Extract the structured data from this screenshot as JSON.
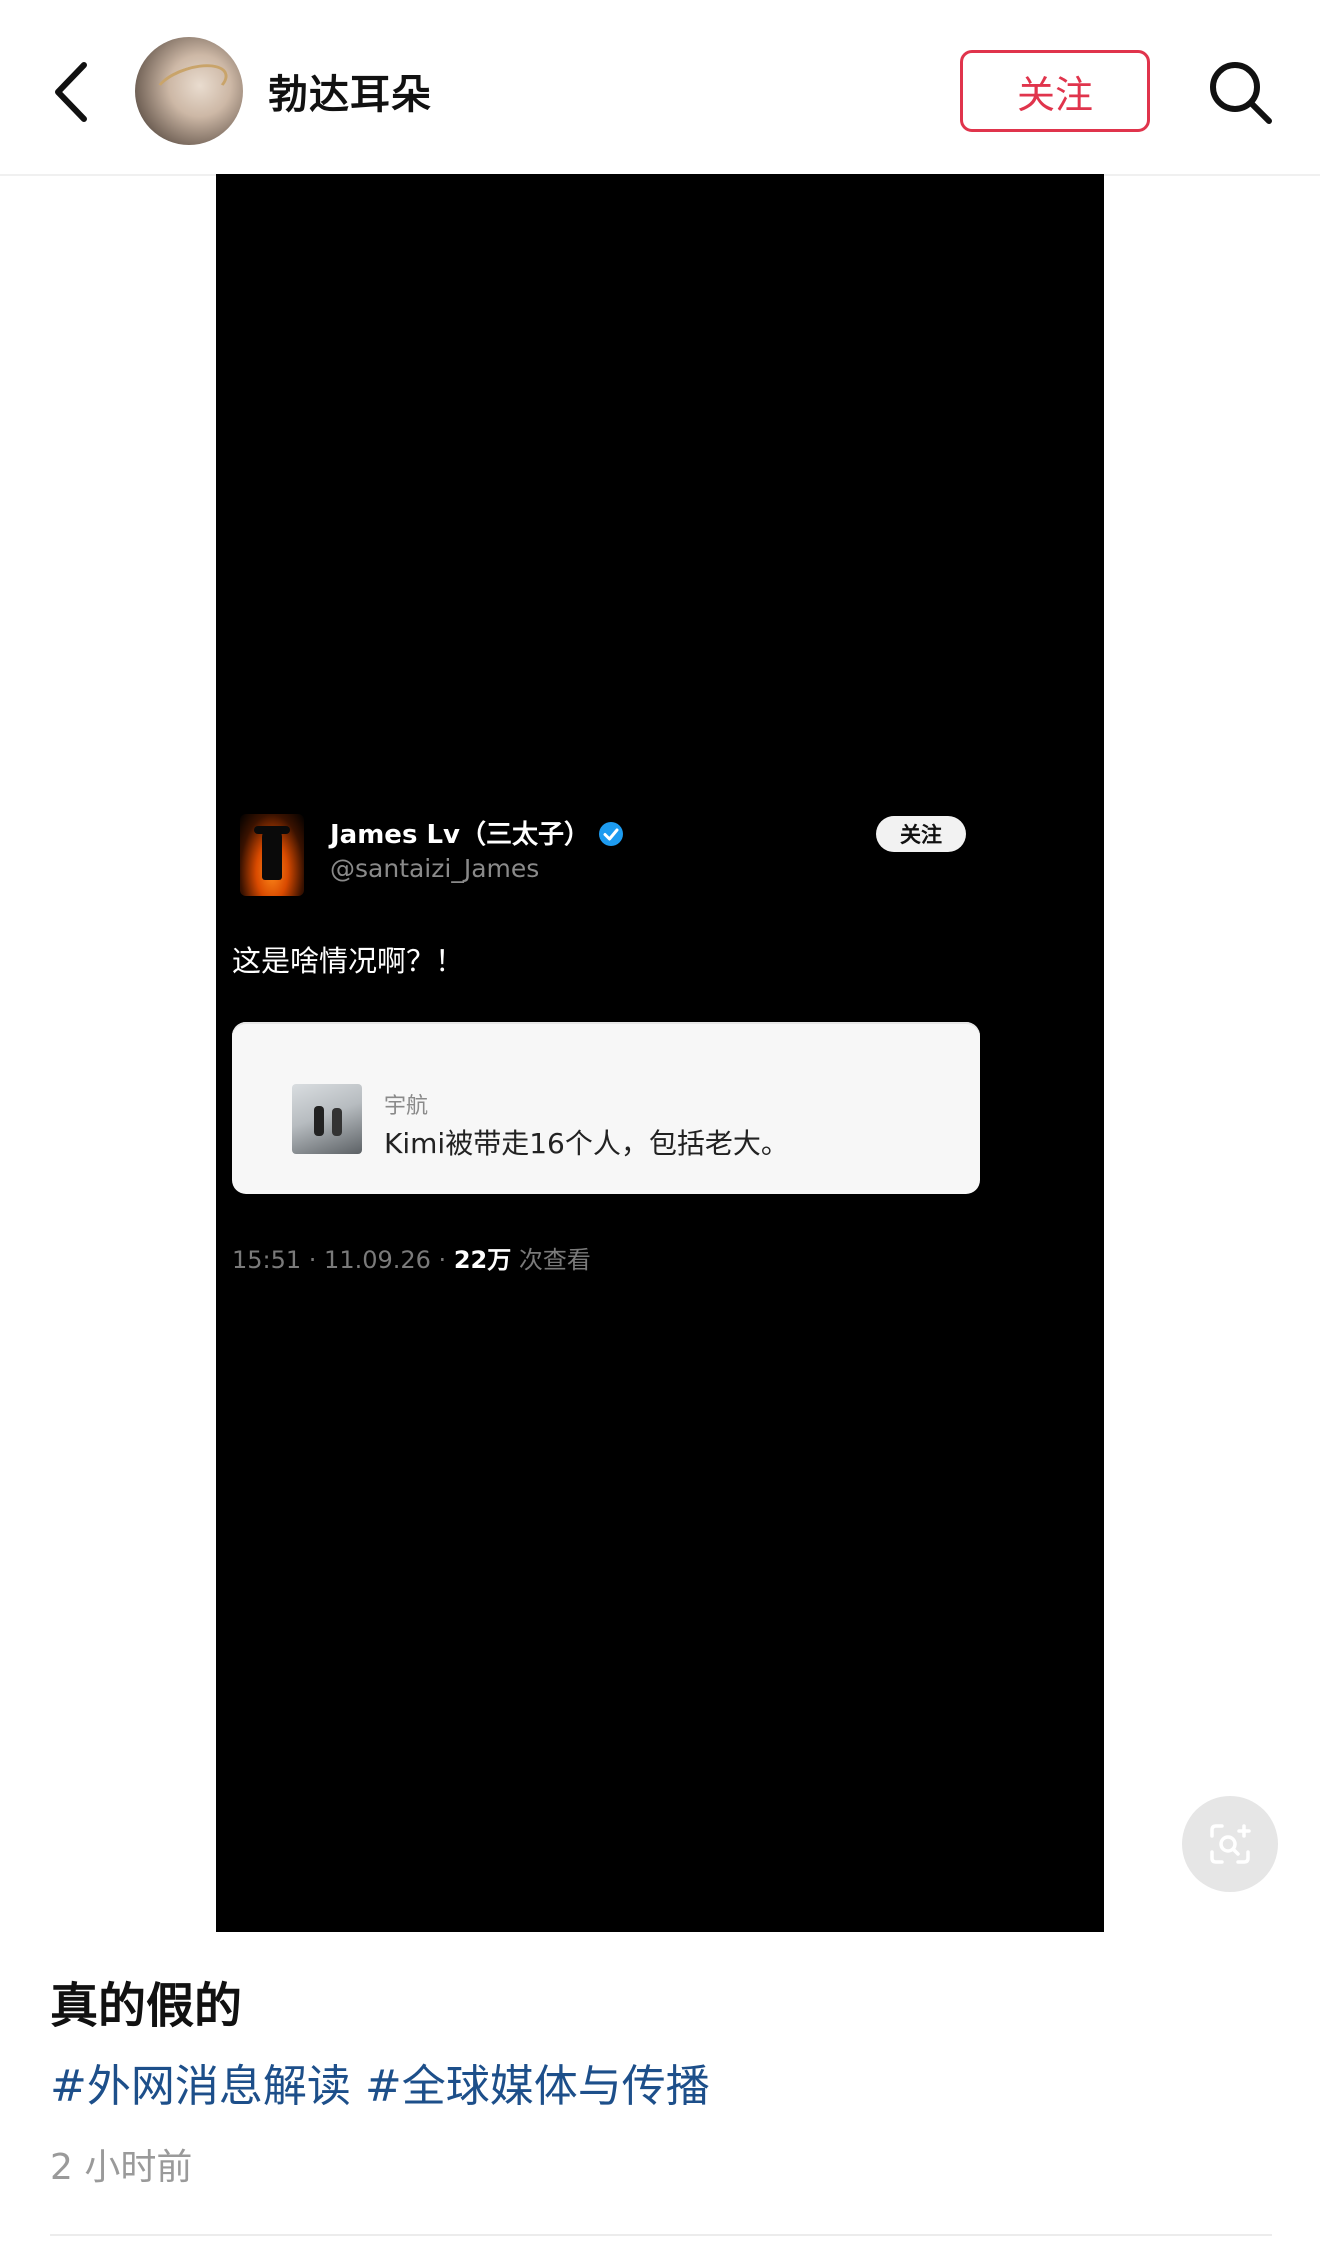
{
  "header": {
    "back_icon": "chevron-left-icon",
    "author_name": "勃达耳朵",
    "follow_label": "关注",
    "search_icon": "search-icon"
  },
  "video": {
    "tweet": {
      "display_name": "James Lv（三太子）",
      "handle": "@santaizi_James",
      "follow_label": "关注",
      "text": "这是啥情况啊？！",
      "quote": {
        "author": "宇航",
        "text": "Kimi被带走16个人，包括老大。"
      },
      "meta_prefix": "15:51 · 11.09.26 · ",
      "views": "22万",
      "views_suffix": " 次查看"
    },
    "scan_icon": "camera-scan-icon"
  },
  "post": {
    "title": "真的假的",
    "hashtags": [
      "#外网消息解读",
      "#全球媒体与传播"
    ],
    "time": "2 小时前"
  },
  "colors": {
    "accent": "#e0344c",
    "hashtag": "#1d4f8a",
    "verified": "#1d9bf0"
  }
}
